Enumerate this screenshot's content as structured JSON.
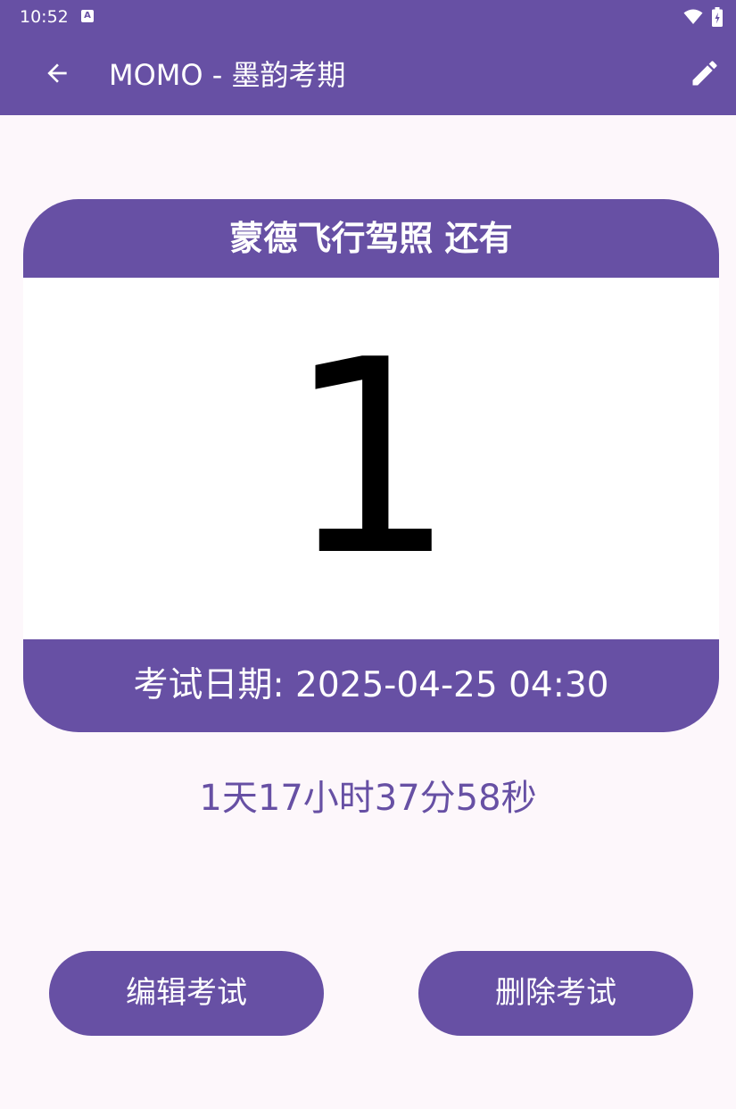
{
  "status_bar": {
    "time": "10:52",
    "notification_icon": "A"
  },
  "app_bar": {
    "title": "MOMO - 墨韵考期",
    "back_icon": "arrow-back-icon",
    "edit_icon": "pencil-icon"
  },
  "exam_card": {
    "header": "蒙德飞行驾照 还有",
    "days": "1",
    "exam_date": "考试日期: 2025-04-25 04:30"
  },
  "countdown": "1天17小时37分58秒",
  "buttons": {
    "edit_exam": "编辑考试",
    "delete_exam": "删除考试"
  },
  "colors": {
    "primary": "#6750a4",
    "background": "#fdf7fb",
    "card_body": "#ffffff"
  }
}
